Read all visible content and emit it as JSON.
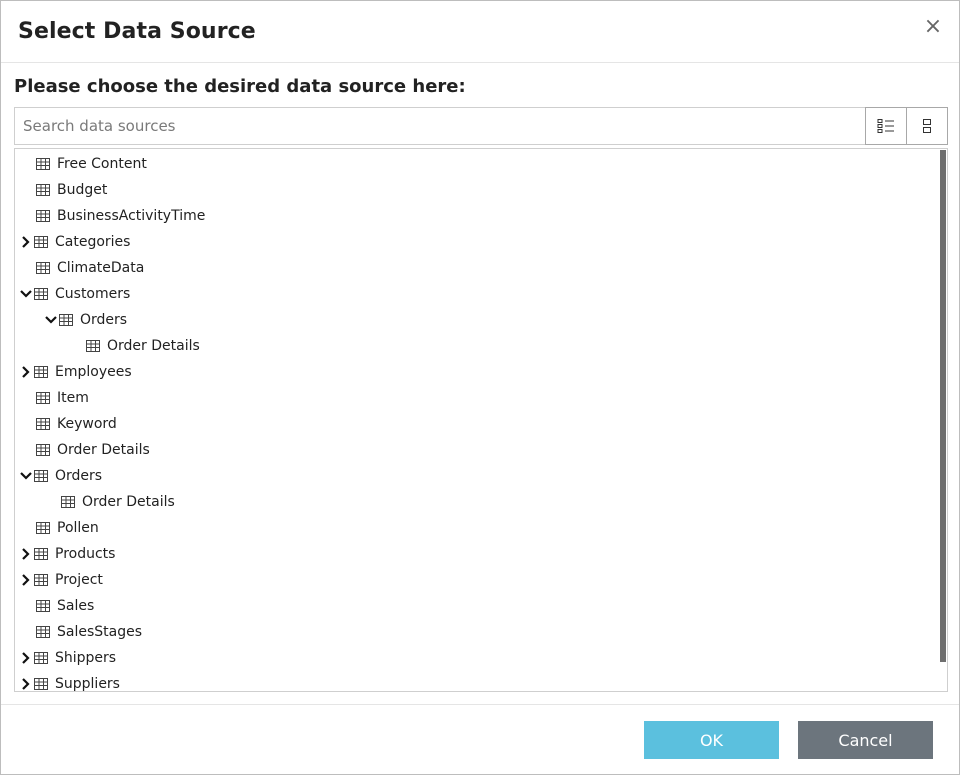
{
  "dialog": {
    "title": "Select Data Source",
    "close_label": "×",
    "subtitle": "Please choose the desired data source here:"
  },
  "search": {
    "placeholder": "Search data sources",
    "value": ""
  },
  "view_buttons": [
    {
      "icon": "list-view-icon"
    },
    {
      "icon": "compact-view-icon"
    }
  ],
  "tree": {
    "items": [
      {
        "label": "Free Content",
        "level": 0,
        "expander": "none"
      },
      {
        "label": "Budget",
        "level": 0,
        "expander": "none"
      },
      {
        "label": "BusinessActivityTime",
        "level": 0,
        "expander": "none"
      },
      {
        "label": "Categories",
        "level": 0,
        "expander": "collapsed"
      },
      {
        "label": "ClimateData",
        "level": 0,
        "expander": "none"
      },
      {
        "label": "Customers",
        "level": 0,
        "expander": "expanded"
      },
      {
        "label": "Orders",
        "level": 1,
        "expander": "expanded"
      },
      {
        "label": "Order Details",
        "level": 2,
        "expander": "none"
      },
      {
        "label": "Employees",
        "level": 0,
        "expander": "collapsed"
      },
      {
        "label": "Item",
        "level": 0,
        "expander": "none"
      },
      {
        "label": "Keyword",
        "level": 0,
        "expander": "none"
      },
      {
        "label": "Order Details",
        "level": 0,
        "expander": "none"
      },
      {
        "label": "Orders",
        "level": 0,
        "expander": "expanded"
      },
      {
        "label": "Order Details",
        "level": 1,
        "expander": "none"
      },
      {
        "label": "Pollen",
        "level": 0,
        "expander": "none"
      },
      {
        "label": "Products",
        "level": 0,
        "expander": "collapsed"
      },
      {
        "label": "Project",
        "level": 0,
        "expander": "collapsed"
      },
      {
        "label": "Sales",
        "level": 0,
        "expander": "none"
      },
      {
        "label": "SalesStages",
        "level": 0,
        "expander": "none"
      },
      {
        "label": "Shippers",
        "level": 0,
        "expander": "collapsed"
      },
      {
        "label": "Suppliers",
        "level": 0,
        "expander": "collapsed"
      }
    ]
  },
  "buttons": {
    "ok_label": "OK",
    "cancel_label": "Cancel"
  },
  "colors": {
    "ok": "#5bc0de",
    "cancel": "#6c757d"
  }
}
